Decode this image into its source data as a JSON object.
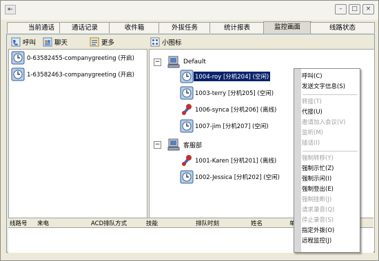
{
  "window": {
    "system_menu": "⇤",
    "min": "–",
    "max": "□",
    "close": "×"
  },
  "tabs": [
    "当前通话",
    "通话记录",
    "收件箱",
    "外拔任务",
    "统计报表",
    "监控画面",
    "线路状态"
  ],
  "active_tab": 5,
  "left_toolbar": {
    "call": "呼叫",
    "chat": "聊天",
    "more": "更多"
  },
  "right_toolbar": {
    "small_icon": "小图标"
  },
  "queue_items": [
    "0-63582455-companygreeting (开启)",
    "1-63582463-companygreeting (开启)"
  ],
  "groups": [
    {
      "name": "Default"
    },
    {
      "name": "客服部"
    }
  ],
  "agents": [
    {
      "label": "1004-roy     [分机204] (空闲)",
      "selected": true,
      "icon": "agent-idle-icon"
    },
    {
      "label": "1003-terry   [分机205] (空闲)",
      "selected": false,
      "icon": "agent-idle-icon"
    },
    {
      "label": "1006-synca   [分机206] (离线)",
      "selected": false,
      "icon": "agent-offline-icon"
    },
    {
      "label": "1007-jim     [分机207] (空闲)",
      "selected": false,
      "icon": "agent-idle-icon"
    },
    {
      "label": "1001-Karen   [分机201] (离线)",
      "selected": false,
      "icon": "agent-offline-icon"
    },
    {
      "label": "1002-Jessica [分机202] (空闲)",
      "selected": false,
      "icon": "agent-idle-icon"
    }
  ],
  "bottom_headers": [
    "线路号",
    "来电",
    "ACD排队方式",
    "技能",
    "排队时刻",
    "姓名",
    "单"
  ],
  "context_menu": [
    {
      "label": "呼叫(C)",
      "enabled": true
    },
    {
      "label": "发送文字信息(S)",
      "enabled": true
    },
    {
      "sep": true
    },
    {
      "label": "转接(T)",
      "enabled": false
    },
    {
      "label": "代接(U)",
      "enabled": true
    },
    {
      "label": "邀请加入会议(V)",
      "enabled": false
    },
    {
      "label": "监听(M)",
      "enabled": false
    },
    {
      "label": "插话(I)",
      "enabled": false
    },
    {
      "sep": true
    },
    {
      "label": "强制转移(Y)",
      "enabled": false
    },
    {
      "label": "强制示忙(Z)",
      "enabled": true
    },
    {
      "label": "强制示闲(I)",
      "enabled": true
    },
    {
      "label": "强制登出(E)",
      "enabled": true
    },
    {
      "label": "强制挂断(J)",
      "enabled": false
    },
    {
      "label": "请求录音(Q)",
      "enabled": false
    },
    {
      "label": "停止录音(S)",
      "enabled": false
    },
    {
      "label": "指定外拨(O)",
      "enabled": true
    },
    {
      "label": "远程监控(J)",
      "enabled": true
    }
  ],
  "colors": {
    "selection": "#0a246a",
    "agent_idle": "#2a5f9e",
    "agent_offline": "#c03030"
  }
}
